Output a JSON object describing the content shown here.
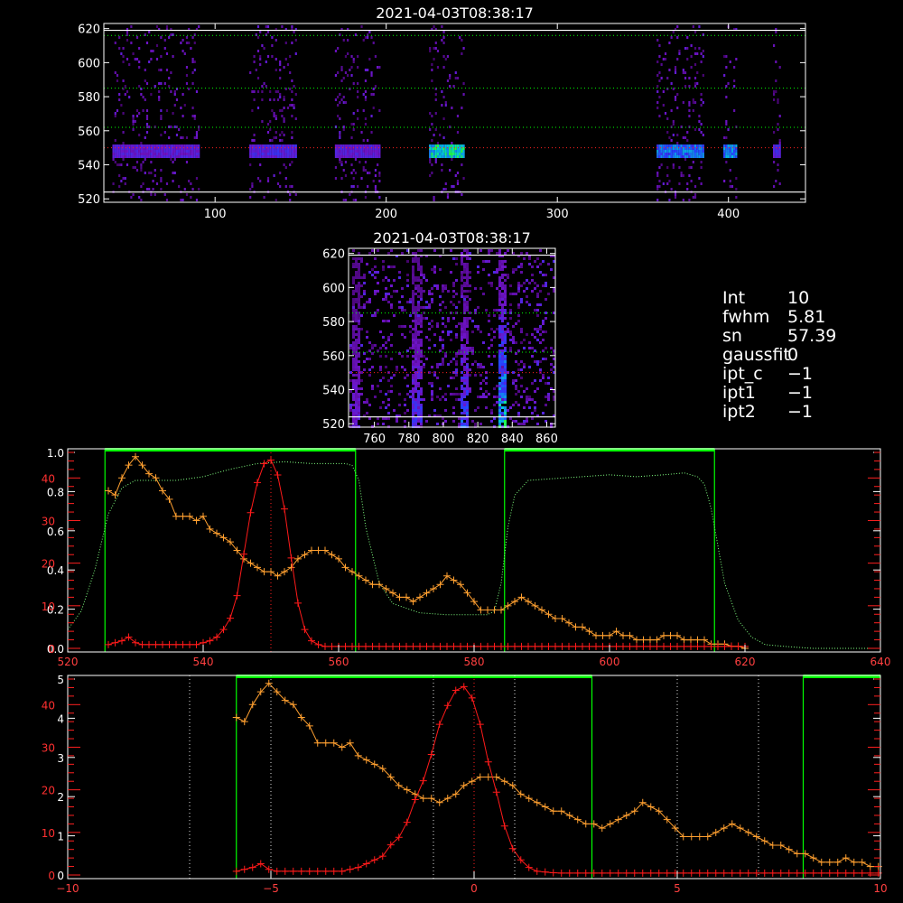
{
  "info_panel": [
    {
      "label": "Int",
      "value": "10"
    },
    {
      "label": "fwhm",
      "value": "5.81"
    },
    {
      "label": "sn",
      "value": "57.39"
    },
    {
      "label": "gaussfit",
      "value": "0"
    },
    {
      "label": "ipt_c",
      "value": "−1"
    },
    {
      "label": "ipt1",
      "value": "−1"
    },
    {
      "label": "ipt2",
      "value": "−1"
    }
  ],
  "chart_data": [
    {
      "type": "heatmap",
      "title": "2021-04-03T08:38:17",
      "xlim": [
        35,
        445
      ],
      "ylim": [
        518,
        623
      ],
      "xticks": [
        100,
        200,
        300,
        400
      ],
      "yticks": [
        520,
        540,
        560,
        580,
        600,
        620
      ],
      "hlines_white": [
        524,
        619
      ],
      "hlines_green_dotted": [
        562,
        585,
        616
      ],
      "hline_red_dotted": 550,
      "signal_blocks": [
        {
          "x0": 40,
          "x1": 90,
          "strength": 0.45
        },
        {
          "x0": 120,
          "x1": 147,
          "strength": 0.5
        },
        {
          "x0": 170,
          "x1": 196,
          "strength": 0.45
        },
        {
          "x0": 225,
          "x1": 245,
          "strength": 0.9
        },
        {
          "x0": 358,
          "x1": 385,
          "strength": 0.7
        },
        {
          "x0": 397,
          "x1": 404,
          "strength": 0.75
        },
        {
          "x0": 426,
          "x1": 430,
          "strength": 0.5
        }
      ],
      "colors": {
        "axis": "#ffffff",
        "green": "#00ff00",
        "red": "#ff2020"
      }
    },
    {
      "type": "heatmap",
      "title": "2021-04-03T08:38:17",
      "xlim": [
        745,
        865
      ],
      "ylim": [
        518,
        623
      ],
      "xticks": [
        760,
        780,
        800,
        820,
        840,
        860
      ],
      "yticks": [
        520,
        540,
        560,
        580,
        600,
        620
      ],
      "hlines_white": [
        524,
        619
      ],
      "hlines_green_dotted": [
        562,
        585
      ],
      "hline_red_dotted": 550,
      "streaks": [
        {
          "x": 749,
          "strength": 0.5
        },
        {
          "x": 784,
          "strength": 0.6
        },
        {
          "x": 812,
          "strength": 0.7
        },
        {
          "x": 833,
          "strength": 1.0
        }
      ]
    },
    {
      "type": "line",
      "xlim": [
        520,
        640
      ],
      "xticks": [
        520,
        540,
        560,
        580,
        600,
        620,
        640
      ],
      "left_axis_black_ticks": [
        "0.0",
        "0.2",
        "0.4",
        "0.6",
        "0.8",
        "1.0"
      ],
      "left_axis_red_ticks": [
        "0",
        "10",
        "20",
        "30",
        "40"
      ],
      "green_bands": [
        [
          525.5,
          562.5
        ],
        [
          584.5,
          615.5
        ]
      ],
      "red_vline_dotted": 550,
      "series": [
        {
          "name": "transmission",
          "style": "green-dotted",
          "ylim": [
            0,
            1.05
          ],
          "x": [
            520,
            522,
            524,
            526,
            528,
            530,
            533,
            536,
            540,
            544,
            548,
            552,
            556,
            559,
            561,
            562,
            563,
            564,
            566,
            568,
            572,
            576,
            580,
            582,
            583,
            584,
            585,
            586,
            588,
            592,
            596,
            600,
            604,
            608,
            611,
            613,
            614,
            615,
            616,
            617,
            619,
            621,
            623,
            626,
            630,
            635,
            640
          ],
          "y": [
            0.1,
            0.2,
            0.42,
            0.72,
            0.86,
            0.9,
            0.9,
            0.9,
            0.92,
            0.96,
            0.99,
            1.0,
            0.99,
            0.99,
            0.99,
            0.98,
            0.9,
            0.65,
            0.35,
            0.24,
            0.19,
            0.18,
            0.18,
            0.18,
            0.2,
            0.35,
            0.65,
            0.82,
            0.9,
            0.91,
            0.92,
            0.93,
            0.92,
            0.93,
            0.94,
            0.92,
            0.88,
            0.75,
            0.55,
            0.35,
            0.15,
            0.06,
            0.02,
            0.01,
            0.0,
            0.0,
            0.0
          ]
        },
        {
          "name": "spectrum",
          "style": "orange-plus",
          "ylim": [
            0,
            46
          ],
          "x": [
            526,
            527,
            528,
            529,
            530,
            531,
            532,
            533,
            534,
            535,
            536,
            537,
            538,
            539,
            540,
            541,
            542,
            543,
            544,
            545,
            546,
            547,
            548,
            549,
            550,
            551,
            552,
            553,
            554,
            555,
            556,
            557,
            558,
            559,
            560,
            561,
            562,
            563,
            564,
            565,
            566,
            567,
            568,
            569,
            570,
            571,
            572,
            573,
            574,
            575,
            576,
            577,
            578,
            579,
            580,
            581,
            582,
            583,
            584,
            585,
            586,
            587,
            588,
            589,
            590,
            591,
            592,
            593,
            594,
            595,
            596,
            597,
            598,
            599,
            600,
            601,
            602,
            603,
            604,
            605,
            606,
            607,
            608,
            609,
            610,
            611,
            612,
            613,
            614,
            615,
            616,
            617,
            618,
            619,
            620
          ],
          "y": [
            37,
            36,
            40,
            43,
            45,
            43,
            41,
            40,
            37,
            35,
            31,
            31,
            31,
            30,
            31,
            28,
            27,
            26,
            25,
            23,
            21,
            20,
            19,
            18,
            18,
            17,
            18,
            19,
            21,
            22,
            23,
            23,
            23,
            22,
            21,
            19,
            18,
            17,
            16,
            15,
            15,
            14,
            13,
            12,
            12,
            11,
            12,
            13,
            14,
            15,
            17,
            16,
            15,
            13,
            11,
            9,
            9,
            9,
            9,
            10,
            11,
            12,
            11,
            10,
            9,
            8,
            7,
            7,
            6,
            5,
            5,
            4,
            3,
            3,
            3,
            4,
            3,
            3,
            2,
            2,
            2,
            2,
            3,
            3,
            3,
            2,
            2,
            2,
            2,
            1,
            1,
            1,
            0.5,
            0.5,
            0
          ]
        },
        {
          "name": "signal",
          "style": "red-plus",
          "ylim": [
            0,
            52
          ],
          "x": [
            526,
            527,
            528,
            529,
            530,
            531,
            532,
            533,
            534,
            535,
            536,
            537,
            538,
            539,
            540,
            541,
            542,
            543,
            544,
            545,
            546,
            547,
            548,
            549,
            550,
            551,
            552,
            553,
            554,
            555,
            556,
            557,
            558,
            559,
            560,
            561,
            562,
            563,
            564,
            565,
            566,
            567,
            568,
            569,
            570,
            571,
            572,
            573,
            574,
            575,
            576,
            577,
            578,
            579,
            580,
            581,
            582,
            583,
            584,
            585,
            586,
            587,
            588,
            589,
            590,
            591,
            592,
            593,
            594,
            595,
            596,
            597,
            598,
            599,
            600,
            601,
            602,
            603,
            604,
            605,
            606,
            607,
            608,
            609,
            610,
            611,
            612,
            613,
            614,
            615,
            616,
            617,
            618,
            619,
            620
          ],
          "y": [
            1,
            1.5,
            2,
            3,
            1.5,
            1,
            1,
            1,
            1,
            1,
            1,
            1,
            1,
            1,
            1.5,
            2,
            3,
            5,
            8,
            14,
            25,
            36,
            44,
            49,
            50,
            46,
            37,
            24,
            12,
            5,
            2,
            1,
            0.5,
            0.5,
            0.5,
            0.5,
            0.5,
            0.5,
            0.5,
            0.5,
            0.5,
            0.5,
            0.5,
            0.5,
            0.5,
            0.5,
            0.5,
            0.5,
            0.5,
            0.5,
            0.5,
            0.5,
            0.5,
            0.5,
            0.5,
            0.5,
            0.5,
            0.5,
            0.5,
            0.5,
            0.5,
            0.5,
            0.5,
            0.5,
            0.5,
            0.5,
            0.5,
            0.5,
            0.5,
            0.5,
            0.5,
            0.5,
            0.5,
            0.5,
            0.5,
            0.5,
            0.5,
            0.5,
            0.5,
            0.5,
            0.5,
            0.5,
            0.5,
            0.5,
            0.5,
            0.5,
            0.5,
            0.5,
            0.5,
            0.5,
            0.5,
            0.5,
            0.5,
            0.5,
            0.5
          ]
        }
      ]
    },
    {
      "type": "line",
      "xlim": [
        -10,
        10
      ],
      "xticks": [
        -10,
        -5,
        0,
        5,
        10
      ],
      "left_axis_black_ticks": [
        "0",
        "1",
        "2",
        "3",
        "4",
        "5"
      ],
      "left_axis_red_ticks": [
        "0",
        "10",
        "20",
        "30",
        "40"
      ],
      "green_bands": [
        [
          -5.85,
          2.9
        ],
        [
          8.1,
          10
        ]
      ],
      "red_vline_dotted": 0,
      "white_vlines_dotted": [
        -7,
        -5,
        -1,
        1,
        5,
        7
      ],
      "series": [
        {
          "name": "spectrum",
          "style": "orange-plus",
          "ylim": [
            0,
            46
          ],
          "x": [
            -5.85,
            -5.65,
            -5.45,
            -5.25,
            -5.05,
            -4.85,
            -4.65,
            -4.45,
            -4.25,
            -4.05,
            -3.85,
            -3.65,
            -3.45,
            -3.25,
            -3.05,
            -2.85,
            -2.65,
            -2.45,
            -2.25,
            -2.05,
            -1.85,
            -1.65,
            -1.45,
            -1.25,
            -1.05,
            -0.85,
            -0.65,
            -0.45,
            -0.25,
            -0.05,
            0.15,
            0.35,
            0.55,
            0.75,
            0.95,
            1.15,
            1.35,
            1.55,
            1.75,
            1.95,
            2.15,
            2.35,
            2.55,
            2.75,
            2.95,
            3.15,
            3.35,
            3.55,
            3.75,
            3.95,
            4.15,
            4.35,
            4.55,
            4.75,
            4.95,
            5.15,
            5.35,
            5.55,
            5.75,
            5.95,
            6.15,
            6.35,
            6.55,
            6.75,
            6.95,
            7.15,
            7.35,
            7.55,
            7.75,
            7.95,
            8.15,
            8.35,
            8.55,
            8.75,
            8.95,
            9.15,
            9.35,
            9.55,
            9.75,
            9.95
          ],
          "y": [
            37,
            36,
            40,
            43,
            45,
            43,
            41,
            40,
            37,
            35,
            31,
            31,
            31,
            30,
            31,
            28,
            27,
            26,
            25,
            23,
            21,
            20,
            19,
            18,
            18,
            17,
            18,
            19,
            21,
            22,
            23,
            23,
            23,
            22,
            21,
            19,
            18,
            17,
            16,
            15,
            15,
            14,
            13,
            12,
            12,
            11,
            12,
            13,
            14,
            15,
            17,
            16,
            15,
            13,
            11,
            9,
            9,
            9,
            9,
            10,
            11,
            12,
            11,
            10,
            9,
            8,
            7,
            7,
            6,
            5,
            5,
            4,
            3,
            3,
            3,
            4,
            3,
            3,
            2,
            2
          ]
        },
        {
          "name": "signal",
          "style": "red-plus",
          "ylim": [
            0,
            52
          ],
          "x": [
            -5.85,
            -5.65,
            -5.45,
            -5.25,
            -5.05,
            -4.85,
            -4.65,
            -4.45,
            -4.25,
            -4.05,
            -3.85,
            -3.65,
            -3.45,
            -3.25,
            -3.05,
            -2.85,
            -2.65,
            -2.45,
            -2.25,
            -2.05,
            -1.85,
            -1.65,
            -1.45,
            -1.25,
            -1.05,
            -0.85,
            -0.65,
            -0.45,
            -0.25,
            -0.05,
            0.15,
            0.35,
            0.55,
            0.75,
            0.95,
            1.15,
            1.35,
            1.55,
            1.75,
            1.95,
            2.15,
            2.35,
            2.55,
            2.75,
            2.95,
            3.15,
            3.35,
            3.55,
            3.75,
            3.95,
            4.15,
            4.35,
            4.55,
            4.75,
            4.95,
            5.15,
            5.35,
            5.55,
            5.75,
            5.95,
            6.15,
            6.35,
            6.55,
            6.75,
            6.95,
            7.15,
            7.35,
            7.55,
            7.75,
            7.95,
            8.15,
            8.35,
            8.55,
            8.75,
            8.95,
            9.15,
            9.35,
            9.55,
            9.75,
            9.95
          ],
          "y": [
            1,
            1.5,
            2,
            3,
            1.5,
            1,
            1,
            1,
            1,
            1,
            1,
            1,
            1,
            1,
            1.5,
            2,
            3,
            4,
            5,
            8,
            10,
            14,
            20,
            25,
            32,
            40,
            45,
            49,
            50,
            47,
            40,
            30,
            22,
            13,
            7,
            4,
            2,
            1,
            0.8,
            0.6,
            0.5,
            0.5,
            0.5,
            0.5,
            0.5,
            0.5,
            0.5,
            0.5,
            0.5,
            0.5,
            0.5,
            0.5,
            0.5,
            0.5,
            0.5,
            0.5,
            0.5,
            0.5,
            0.5,
            0.5,
            0.5,
            0.5,
            0.5,
            0.5,
            0.5,
            0.5,
            0.5,
            0.5,
            0.5,
            0.5,
            0.5,
            0.5,
            0.5,
            0.5,
            0.5,
            0.5,
            0.5,
            0.5,
            0.5,
            0.5
          ]
        }
      ]
    }
  ]
}
